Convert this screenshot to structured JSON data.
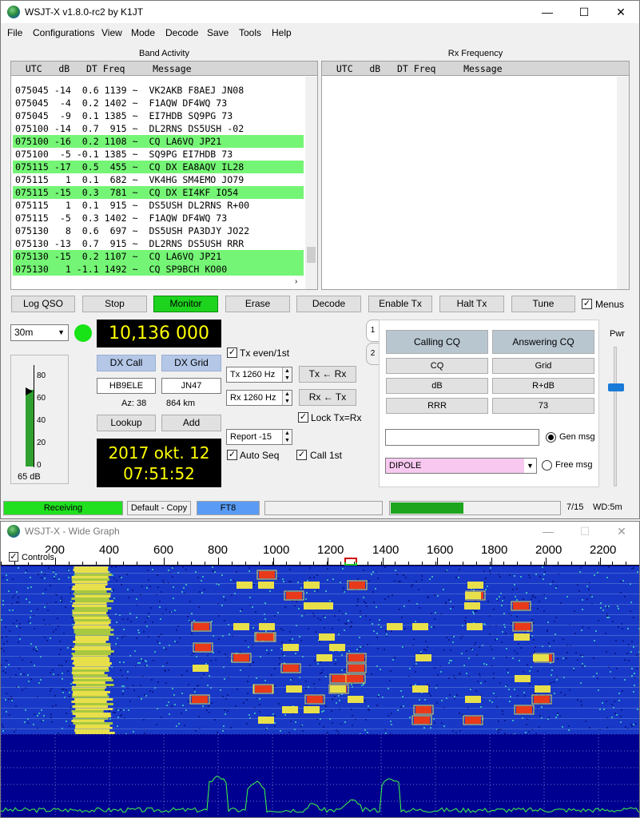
{
  "app": {
    "title": "WSJT-X   v1.8.0-rc2   by K1JT",
    "window_controls": [
      "—",
      "☐",
      "✕"
    ]
  },
  "menu": [
    "File",
    "Configurations",
    "View",
    "Mode",
    "Decode",
    "Save",
    "Tools",
    "Help"
  ],
  "band_activity": {
    "title": "Band Activity",
    "header": "  UTC   dB   DT Freq     Message",
    "rows": [
      {
        "text": "075045 -14  0.6 1139 ~  VK2AKB F8AEJ JN08",
        "cq": false
      },
      {
        "text": "075045  -4  0.2 1402 ~  F1AQW DF4WQ 73",
        "cq": false
      },
      {
        "text": "075045  -9  0.1 1385 ~  EI7HDB SQ9PG 73",
        "cq": false
      },
      {
        "text": "075100 -14  0.7  915 ~  DL2RNS DS5USH -02",
        "cq": false
      },
      {
        "text": "075100 -16  0.2 1108 ~  CQ LA6VQ JP21",
        "cq": true
      },
      {
        "text": "075100  -5 -0.1 1385 ~  SQ9PG EI7HDB 73",
        "cq": false
      },
      {
        "text": "075115 -17  0.5  455 ~  CQ DX EA8AQV IL28",
        "cq": true
      },
      {
        "text": "075115   1  0.1  682 ~  VK4HG SM4EMO JO79",
        "cq": false
      },
      {
        "text": "075115 -15  0.3  781 ~  CQ DX EI4KF IO54",
        "cq": true
      },
      {
        "text": "075115   1  0.1  915 ~  DS5USH DL2RNS R+00",
        "cq": false
      },
      {
        "text": "075115  -5  0.3 1402 ~  F1AQW DF4WQ 73",
        "cq": false
      },
      {
        "text": "075130   8  0.6  697 ~  DS5USH PA3DJY JO22",
        "cq": false
      },
      {
        "text": "075130 -13  0.7  915 ~  DL2RNS DS5USH RRR",
        "cq": false
      },
      {
        "text": "075130 -15  0.2 1107 ~  CQ LA6VQ JP21",
        "cq": true
      },
      {
        "text": "075130   1 -1.1 1492 ~  CQ SP9BCH KO00",
        "cq": true
      }
    ]
  },
  "rx_frequency": {
    "title": "Rx Frequency",
    "header": "  UTC   dB   DT Freq     Message"
  },
  "buttons": {
    "log_qso": "Log QSO",
    "stop": "Stop",
    "monitor": "Monitor",
    "erase": "Erase",
    "decode": "Decode",
    "enable_tx": "Enable Tx",
    "halt_tx": "Halt Tx",
    "tune": "Tune",
    "menus": "Menus"
  },
  "controls": {
    "band": "30m",
    "dial_frequency": "10,136 000",
    "dx_call_label": "DX Call",
    "dx_grid_label": "DX Grid",
    "dx_call": "HB9ELE",
    "dx_grid": "JN47",
    "az": "Az: 38",
    "distance": "864 km",
    "lookup": "Lookup",
    "add": "Add",
    "date": "2017 okt. 12",
    "time": "07:51:52",
    "tx_even": "Tx even/1st",
    "tx_freq": "Tx  1260  Hz",
    "rx_freq": "Rx  1260  Hz",
    "tx_from_rx": "Tx ← Rx",
    "rx_from_tx": "Rx ← Tx",
    "lock": "Lock Tx=Rx",
    "report": "Report  -15",
    "auto_seq": "Auto Seq",
    "call_1st": "Call 1st",
    "level_db": "65 dB",
    "meter_ticks": [
      "80",
      "60",
      "40",
      "20",
      "0"
    ],
    "pwr_label": "Pwr"
  },
  "tab_panel": {
    "tab1": "1",
    "tab2": "2",
    "calling_cq": "Calling CQ",
    "answering_cq": "Answering CQ",
    "cq": "CQ",
    "grid": "Grid",
    "db": "dB",
    "r_db": "R+dB",
    "rrr": "RRR",
    "seventy_three": "73",
    "gen_msg": "Gen msg",
    "free_msg_value": "DIPOLE",
    "free_msg": "Free msg"
  },
  "status": {
    "receiving": "Receiving",
    "config": "Default - Copy",
    "mode": "FT8",
    "progress": 0.43,
    "count": "7/15",
    "wd": "WD:5m"
  },
  "wide_graph": {
    "title": "WSJT-X - Wide Graph",
    "controls": "Controls",
    "ticks": [
      "200",
      "400",
      "600",
      "800",
      "1000",
      "1200",
      "1400",
      "1600",
      "1800",
      "2000",
      "2200"
    ],
    "colors": {
      "background": "#0000a0",
      "signal": "#e8e04a",
      "strong": "#e83a1a",
      "spectrum": "#40ff40"
    }
  }
}
